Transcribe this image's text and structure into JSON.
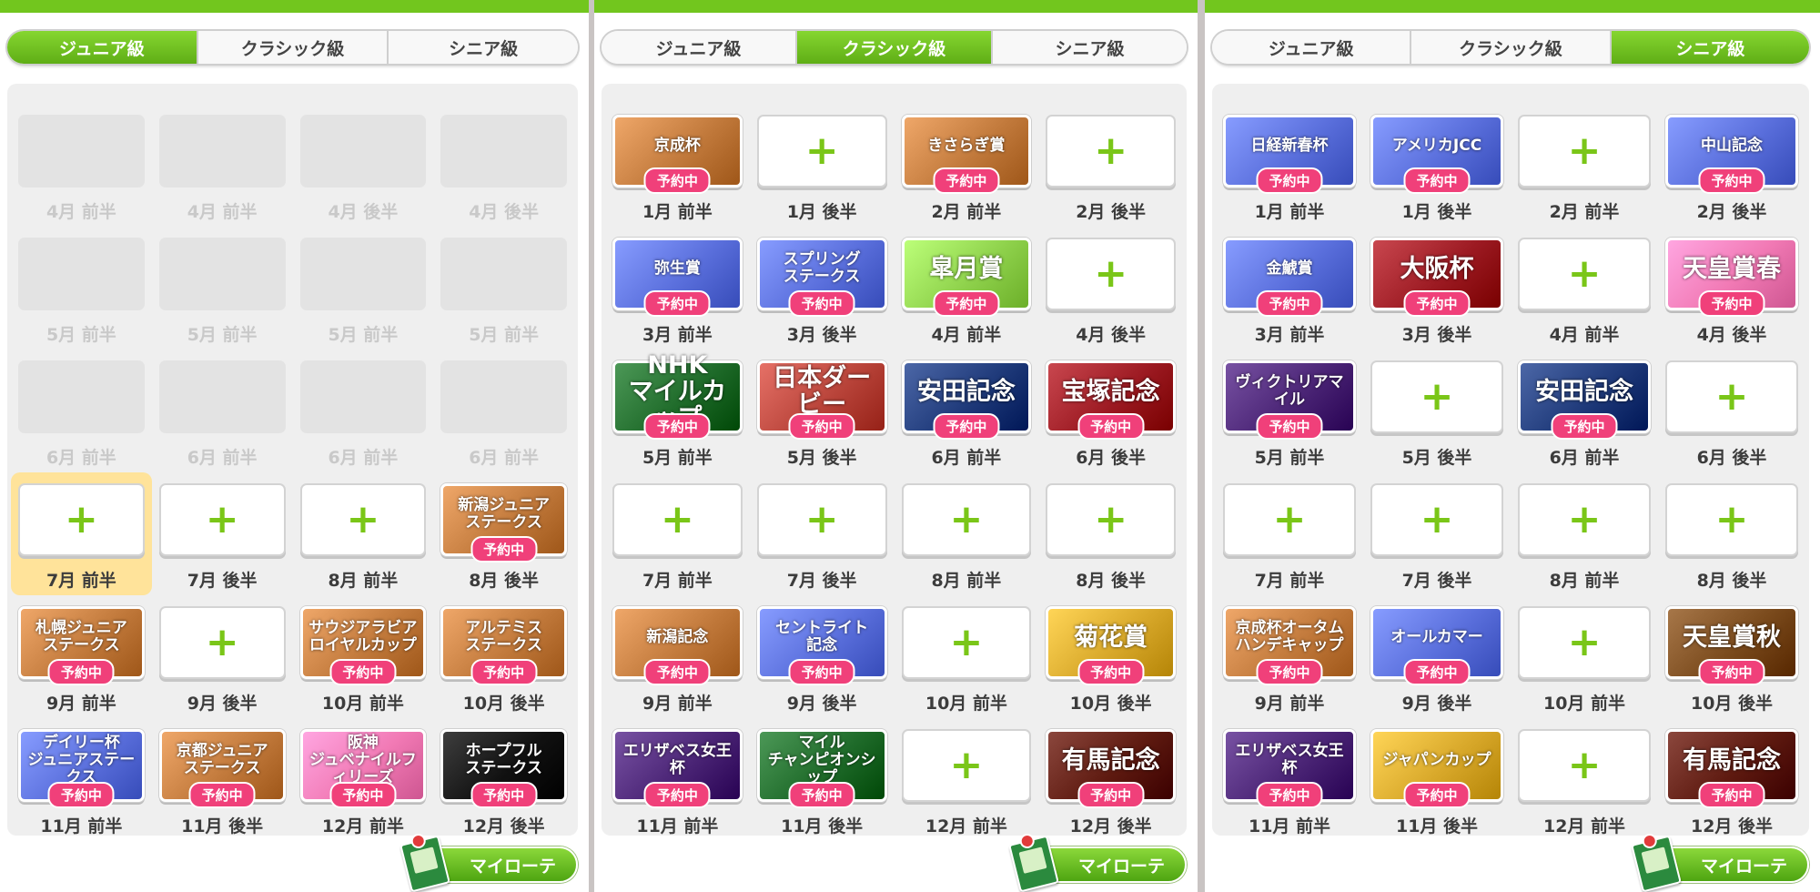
{
  "theme": {
    "orange": "#c27a3c",
    "blue": "#5a6fdc",
    "green": "#8fd24c",
    "dark_green": "#1f6b2a",
    "cream": "#b9443a",
    "navy": "#1f3a7a",
    "crimson": "#9c1a22",
    "pink": "#f179b4",
    "black": "#111111",
    "purple": "#4b2576",
    "gold": "#d8a82a",
    "darkred": "#5e1a10",
    "brown": "#7a4a1c",
    "badge": "#f0407a",
    "plus_green": "#7ac618"
  },
  "panels": [
    {
      "title": "",
      "tabs": [
        "ジュニア級",
        "クラシック級",
        "シニア級"
      ],
      "active_tab": 0,
      "cells": [
        {
          "label": "4月 前半",
          "state": "empty"
        },
        {
          "label": "4月 前半",
          "state": "empty"
        },
        {
          "label": "4月 後半",
          "state": "empty"
        },
        {
          "label": "4月 後半",
          "state": "empty"
        },
        {
          "label": "5月 前半",
          "state": "empty"
        },
        {
          "label": "5月 前半",
          "state": "empty"
        },
        {
          "label": "5月 前半",
          "state": "empty"
        },
        {
          "label": "5月 前半",
          "state": "empty"
        },
        {
          "label": "6月 前半",
          "state": "empty"
        },
        {
          "label": "6月 前半",
          "state": "empty"
        },
        {
          "label": "6月 前半",
          "state": "empty"
        },
        {
          "label": "6月 前半",
          "state": "empty"
        },
        {
          "label": "7月 前半",
          "state": "add",
          "highlight": true
        },
        {
          "label": "7月 後半",
          "state": "add"
        },
        {
          "label": "8月 前半",
          "state": "add"
        },
        {
          "label": "8月 後半",
          "state": "race",
          "race": "新潟ジュニア\nステークス",
          "color": "orange"
        },
        {
          "label": "9月 前半",
          "state": "race",
          "race": "札幌ジュニア\nステークス",
          "color": "orange"
        },
        {
          "label": "9月 後半",
          "state": "add"
        },
        {
          "label": "10月 前半",
          "state": "race",
          "race": "サウジアラビア\nロイヤルカップ",
          "color": "orange"
        },
        {
          "label": "10月 後半",
          "state": "race",
          "race": "アルテミス\nステークス",
          "color": "orange"
        },
        {
          "label": "11月 前半",
          "state": "race",
          "race": "デイリー杯\nジュニアステークス",
          "color": "blue"
        },
        {
          "label": "11月 後半",
          "state": "race",
          "race": "京都ジュニア\nステークス",
          "color": "orange"
        },
        {
          "label": "12月 前半",
          "state": "race",
          "race": "阪神\nジュベナイルフィリーズ",
          "color": "pink"
        },
        {
          "label": "12月 後半",
          "state": "race",
          "race": "ホープフル\nステークス",
          "color": "black"
        }
      ]
    },
    {
      "title": "",
      "tabs": [
        "ジュニア級",
        "クラシック級",
        "シニア級"
      ],
      "active_tab": 1,
      "cells": [
        {
          "label": "1月 前半",
          "state": "race",
          "race": "京成杯",
          "color": "orange"
        },
        {
          "label": "1月 後半",
          "state": "add"
        },
        {
          "label": "2月 前半",
          "state": "race",
          "race": "きさらぎ賞",
          "color": "orange"
        },
        {
          "label": "2月 後半",
          "state": "add"
        },
        {
          "label": "3月 前半",
          "state": "race",
          "race": "弥生賞",
          "color": "blue"
        },
        {
          "label": "3月 後半",
          "state": "race",
          "race": "スプリング\nステークス",
          "color": "blue"
        },
        {
          "label": "4月 前半",
          "state": "race",
          "race": "皐月賞",
          "color": "green",
          "big": true
        },
        {
          "label": "4月 後半",
          "state": "add"
        },
        {
          "label": "5月 前半",
          "state": "race",
          "race": "NHK\nマイルカップ",
          "color": "dark_green",
          "big": true
        },
        {
          "label": "5月 後半",
          "state": "race",
          "race": "日本ダービー",
          "color": "cream",
          "big": true
        },
        {
          "label": "6月 前半",
          "state": "race",
          "race": "安田記念",
          "color": "navy",
          "big": true
        },
        {
          "label": "6月 後半",
          "state": "race",
          "race": "宝塚記念",
          "color": "crimson",
          "big": true
        },
        {
          "label": "7月 前半",
          "state": "add"
        },
        {
          "label": "7月 後半",
          "state": "add"
        },
        {
          "label": "8月 前半",
          "state": "add"
        },
        {
          "label": "8月 後半",
          "state": "add"
        },
        {
          "label": "9月 前半",
          "state": "race",
          "race": "新潟記念",
          "color": "orange"
        },
        {
          "label": "9月 後半",
          "state": "race",
          "race": "セントライト\n記念",
          "color": "blue"
        },
        {
          "label": "10月 前半",
          "state": "add"
        },
        {
          "label": "10月 後半",
          "state": "race",
          "race": "菊花賞",
          "color": "gold",
          "big": true
        },
        {
          "label": "11月 前半",
          "state": "race",
          "race": "エリザベス女王杯",
          "color": "purple"
        },
        {
          "label": "11月 後半",
          "state": "race",
          "race": "マイル\nチャンピオンシップ",
          "color": "dark_green"
        },
        {
          "label": "12月 前半",
          "state": "add"
        },
        {
          "label": "12月 後半",
          "state": "race",
          "race": "有馬記念",
          "color": "darkred",
          "big": true
        }
      ]
    },
    {
      "title": "",
      "tabs": [
        "ジュニア級",
        "クラシック級",
        "シニア級"
      ],
      "active_tab": 2,
      "cells": [
        {
          "label": "1月 前半",
          "state": "race",
          "race": "日経新春杯",
          "color": "blue"
        },
        {
          "label": "1月 後半",
          "state": "race",
          "race": "アメリカJCC",
          "color": "blue"
        },
        {
          "label": "2月 前半",
          "state": "add"
        },
        {
          "label": "2月 後半",
          "state": "race",
          "race": "中山記念",
          "color": "blue"
        },
        {
          "label": "3月 前半",
          "state": "race",
          "race": "金鯱賞",
          "color": "blue"
        },
        {
          "label": "3月 後半",
          "state": "race",
          "race": "大阪杯",
          "color": "crimson",
          "big": true
        },
        {
          "label": "4月 前半",
          "state": "add"
        },
        {
          "label": "4月 後半",
          "state": "race",
          "race": "天皇賞春",
          "color": "pink",
          "big": true
        },
        {
          "label": "5月 前半",
          "state": "race",
          "race": "ヴィクトリアマイル",
          "color": "purple"
        },
        {
          "label": "5月 後半",
          "state": "add"
        },
        {
          "label": "6月 前半",
          "state": "race",
          "race": "安田記念",
          "color": "navy",
          "big": true
        },
        {
          "label": "6月 後半",
          "state": "add"
        },
        {
          "label": "7月 前半",
          "state": "add"
        },
        {
          "label": "7月 後半",
          "state": "add"
        },
        {
          "label": "8月 前半",
          "state": "add"
        },
        {
          "label": "8月 後半",
          "state": "add"
        },
        {
          "label": "9月 前半",
          "state": "race",
          "race": "京成杯オータム\nハンデキャップ",
          "color": "orange"
        },
        {
          "label": "9月 後半",
          "state": "race",
          "race": "オールカマー",
          "color": "blue"
        },
        {
          "label": "10月 前半",
          "state": "add"
        },
        {
          "label": "10月 後半",
          "state": "race",
          "race": "天皇賞秋",
          "color": "brown",
          "big": true
        },
        {
          "label": "11月 前半",
          "state": "race",
          "race": "エリザベス女王杯",
          "color": "purple"
        },
        {
          "label": "11月 後半",
          "state": "race",
          "race": "ジャパンカップ",
          "color": "gold"
        },
        {
          "label": "12月 前半",
          "state": "add"
        },
        {
          "label": "12月 後半",
          "state": "race",
          "race": "有馬記念",
          "color": "darkred",
          "big": true
        }
      ]
    }
  ],
  "badge_text": "予約中",
  "plus_symbol": "+",
  "myroute_label": "マイローテ"
}
